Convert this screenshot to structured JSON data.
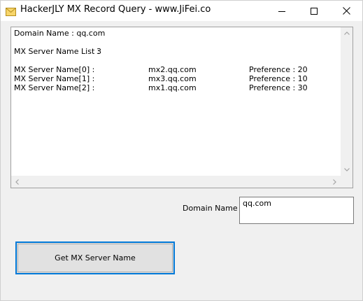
{
  "window": {
    "title": "HackerJLY MX Record Query - www.JiFei.co",
    "icon": "envelope-icon",
    "controls": {
      "minimize": "minimize-icon",
      "maximize": "maximize-icon",
      "close": "close-icon"
    }
  },
  "output": {
    "domain_line": "Domain Name : qq.com",
    "list_label": "MX Server Name List :",
    "list_count": "3",
    "servers": [
      {
        "label": "MX Server Name[0] :",
        "host": "mx2.qq.com",
        "preference": "Preference : 20"
      },
      {
        "label": "MX Server Name[1] :",
        "host": "mx3.qq.com",
        "preference": "Preference : 10"
      },
      {
        "label": "MX Server Name[2] :",
        "host": "mx1.qq.com",
        "preference": "Preference : 30"
      }
    ]
  },
  "form": {
    "domain_label": "Domain Name :",
    "domain_value": "qq.com",
    "button_label": "Get MX Server Name"
  },
  "colors": {
    "focus_border": "#0078d7",
    "window_bg": "#f0f0f0",
    "button_bg": "#e1e1e1"
  }
}
